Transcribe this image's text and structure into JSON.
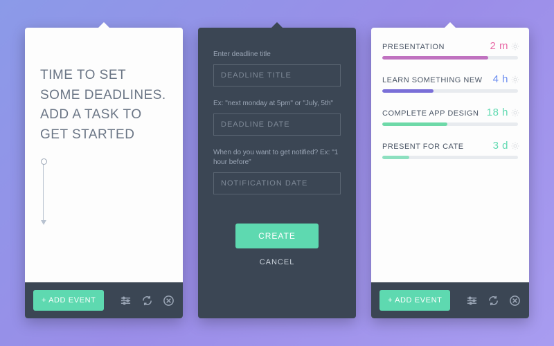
{
  "intro": {
    "text": "TIME TO SET SOME DEADLINES. ADD A TASK TO GET STARTED"
  },
  "footer": {
    "add_label": "+ ADD EVENT"
  },
  "form": {
    "title_label": "Enter deadline title",
    "title_placeholder": "DEADLINE TITLE",
    "date_label": "Ex: \"next monday at 5pm\" or \"July, 5th\"",
    "date_placeholder": "DEADLINE DATE",
    "notify_label": "When do you want to get notified? Ex: \"1 hour before\"",
    "notify_placeholder": "NOTIFICATION DATE",
    "create_label": "CREATE",
    "cancel_label": "CANCEL"
  },
  "events": [
    {
      "title": "PRESENTATION",
      "time": "2 m",
      "time_color": "#e86aa6",
      "bar_color": "#c072c0",
      "progress": 78
    },
    {
      "title": "LEARN SOMETHING NEW",
      "time": "4 h",
      "time_color": "#6a8cf0",
      "bar_color": "#7a6fd8",
      "progress": 38
    },
    {
      "title": "COMPLETE APP DESIGN",
      "time": "18 h",
      "time_color": "#5ed9b0",
      "bar_color": "#6ed9a8",
      "progress": 48
    },
    {
      "title": "PRESENT FOR CATE",
      "time": "3 d",
      "time_color": "#5ed9b0",
      "bar_color": "#8de0c0",
      "progress": 20
    }
  ]
}
